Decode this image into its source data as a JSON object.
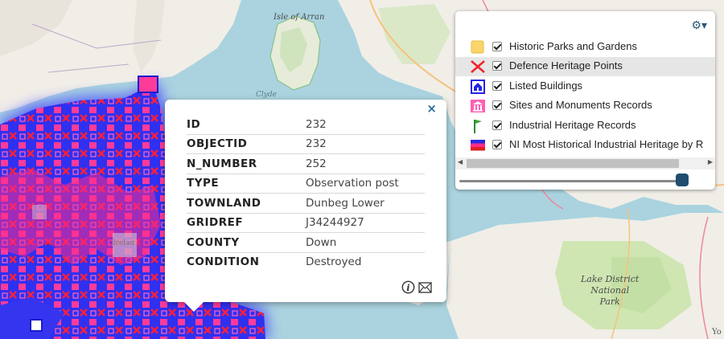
{
  "map": {
    "place_labels": {
      "arran": "Isle of Arran",
      "clyde": "Clyde",
      "lake_district": "Lake District\nNational\nPark",
      "ireland_partial": "Irelan",
      "yo_partial": "Yo"
    },
    "colors": {
      "sea": "#aad3df",
      "land": "#f1eee8",
      "green": "#cde6b3",
      "heritage_blue": "#2f2ff0",
      "heritage_pink": "#ff1e8c",
      "heritage_red": "#ff2020"
    }
  },
  "popup": {
    "close_label": "×",
    "rows": [
      {
        "key": "ID",
        "value": "232"
      },
      {
        "key": "OBJECTID",
        "value": "232"
      },
      {
        "key": "N_NUMBER",
        "value": "252"
      },
      {
        "key": "TYPE",
        "value": "Observation post"
      },
      {
        "key": "TOWNLAND",
        "value": "Dunbeg Lower"
      },
      {
        "key": "GRIDREF",
        "value": "J34244927"
      },
      {
        "key": "COUNTY",
        "value": "Down"
      },
      {
        "key": "CONDITION",
        "value": "Destroyed"
      }
    ],
    "tools": [
      "info-icon",
      "mail-icon"
    ]
  },
  "legend": {
    "settings_icon": "gear-icon",
    "layers": [
      {
        "label": "Historic Parks and Gardens",
        "icon": "yellow-square-icon",
        "checked": true,
        "highlighted": false
      },
      {
        "label": "Defence Heritage Points",
        "icon": "red-cross-icon",
        "checked": true,
        "highlighted": true
      },
      {
        "label": "Listed Buildings",
        "icon": "blue-house-icon",
        "checked": true,
        "highlighted": false
      },
      {
        "label": "Sites and Monuments Records",
        "icon": "pink-temple-icon",
        "checked": true,
        "highlighted": false
      },
      {
        "label": "Industrial Heritage Records",
        "icon": "green-flag-icon",
        "checked": true,
        "highlighted": false
      },
      {
        "label": "NI Most Historical Industrial Heritage by R",
        "icon": "striped-flag-icon",
        "checked": true,
        "highlighted": false
      }
    ],
    "opacity": 1.0
  }
}
